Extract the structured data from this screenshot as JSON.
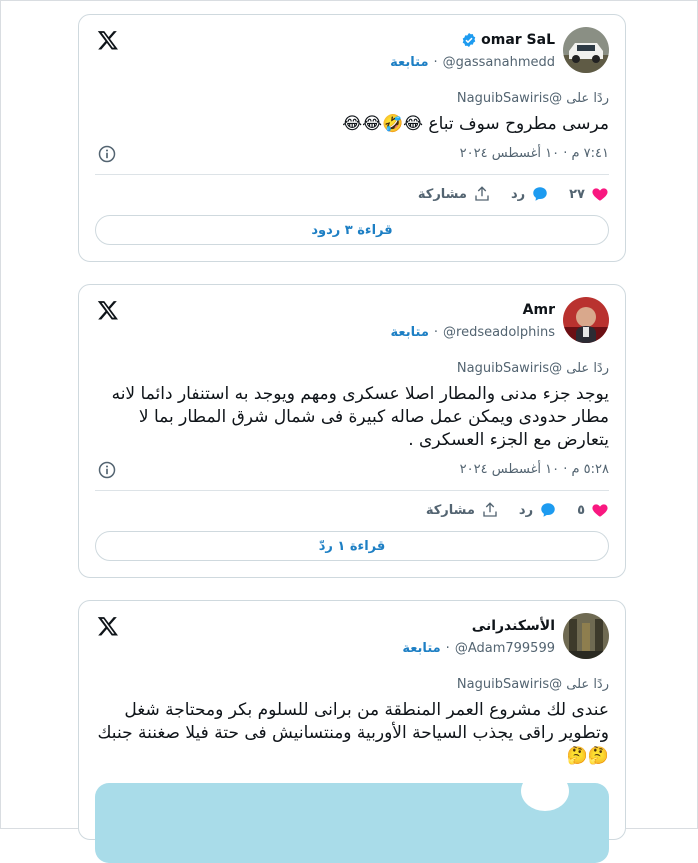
{
  "tweets": [
    {
      "name": "omar SaL",
      "verified": true,
      "handle": "@gassanahmedd",
      "follow": "متابعة",
      "reply_to": "ردًا على @NaguibSawiris",
      "text": "مرسى مطروح سوف تباع 😂🤣😂😂",
      "time": "٧:٤١ م · ١٠ أغسطس ٢٠٢٤",
      "likes": "٢٧",
      "reply_label": "رد",
      "share_label": "مشاركة",
      "read_more": "قراءة ٣ ردود"
    },
    {
      "name": "Amr",
      "verified": false,
      "handle": "@redseadolphins",
      "follow": "متابعة",
      "reply_to": "ردًا على @NaguibSawiris",
      "text": "يوجد جزء مدنى والمطار اصلا عسكرى ومهم ويوجد به استنفار دائما لانه مطار حدودى ويمكن عمل صاله كبيرة فى شمال شرق المطار بما لا يتعارض مع الجزء العسكرى .",
      "time": "٥:٢٨ م · ١٠ أغسطس ٢٠٢٤",
      "likes": "٥",
      "reply_label": "رد",
      "share_label": "مشاركة",
      "read_more": "قراءة ١ ردّ"
    },
    {
      "name": "الأسكندرانى",
      "verified": false,
      "handle": "@Adam799599",
      "follow": "متابعة",
      "reply_to": "ردًا على @NaguibSawiris",
      "text": "عندى لك مشروع العمر المنطقة من برانى للسلوم بكر ومحتاجة شغل وتطوير راقى يجذب السياحة الأوربية ومنتسانيش فى حتة فيلا صغننة جنبك 🤔🤔"
    }
  ],
  "colors": {
    "accent": "#1d7fc4",
    "like": "#f91880",
    "reply": "#1d9bf0",
    "verified": "#1d9bf0"
  }
}
